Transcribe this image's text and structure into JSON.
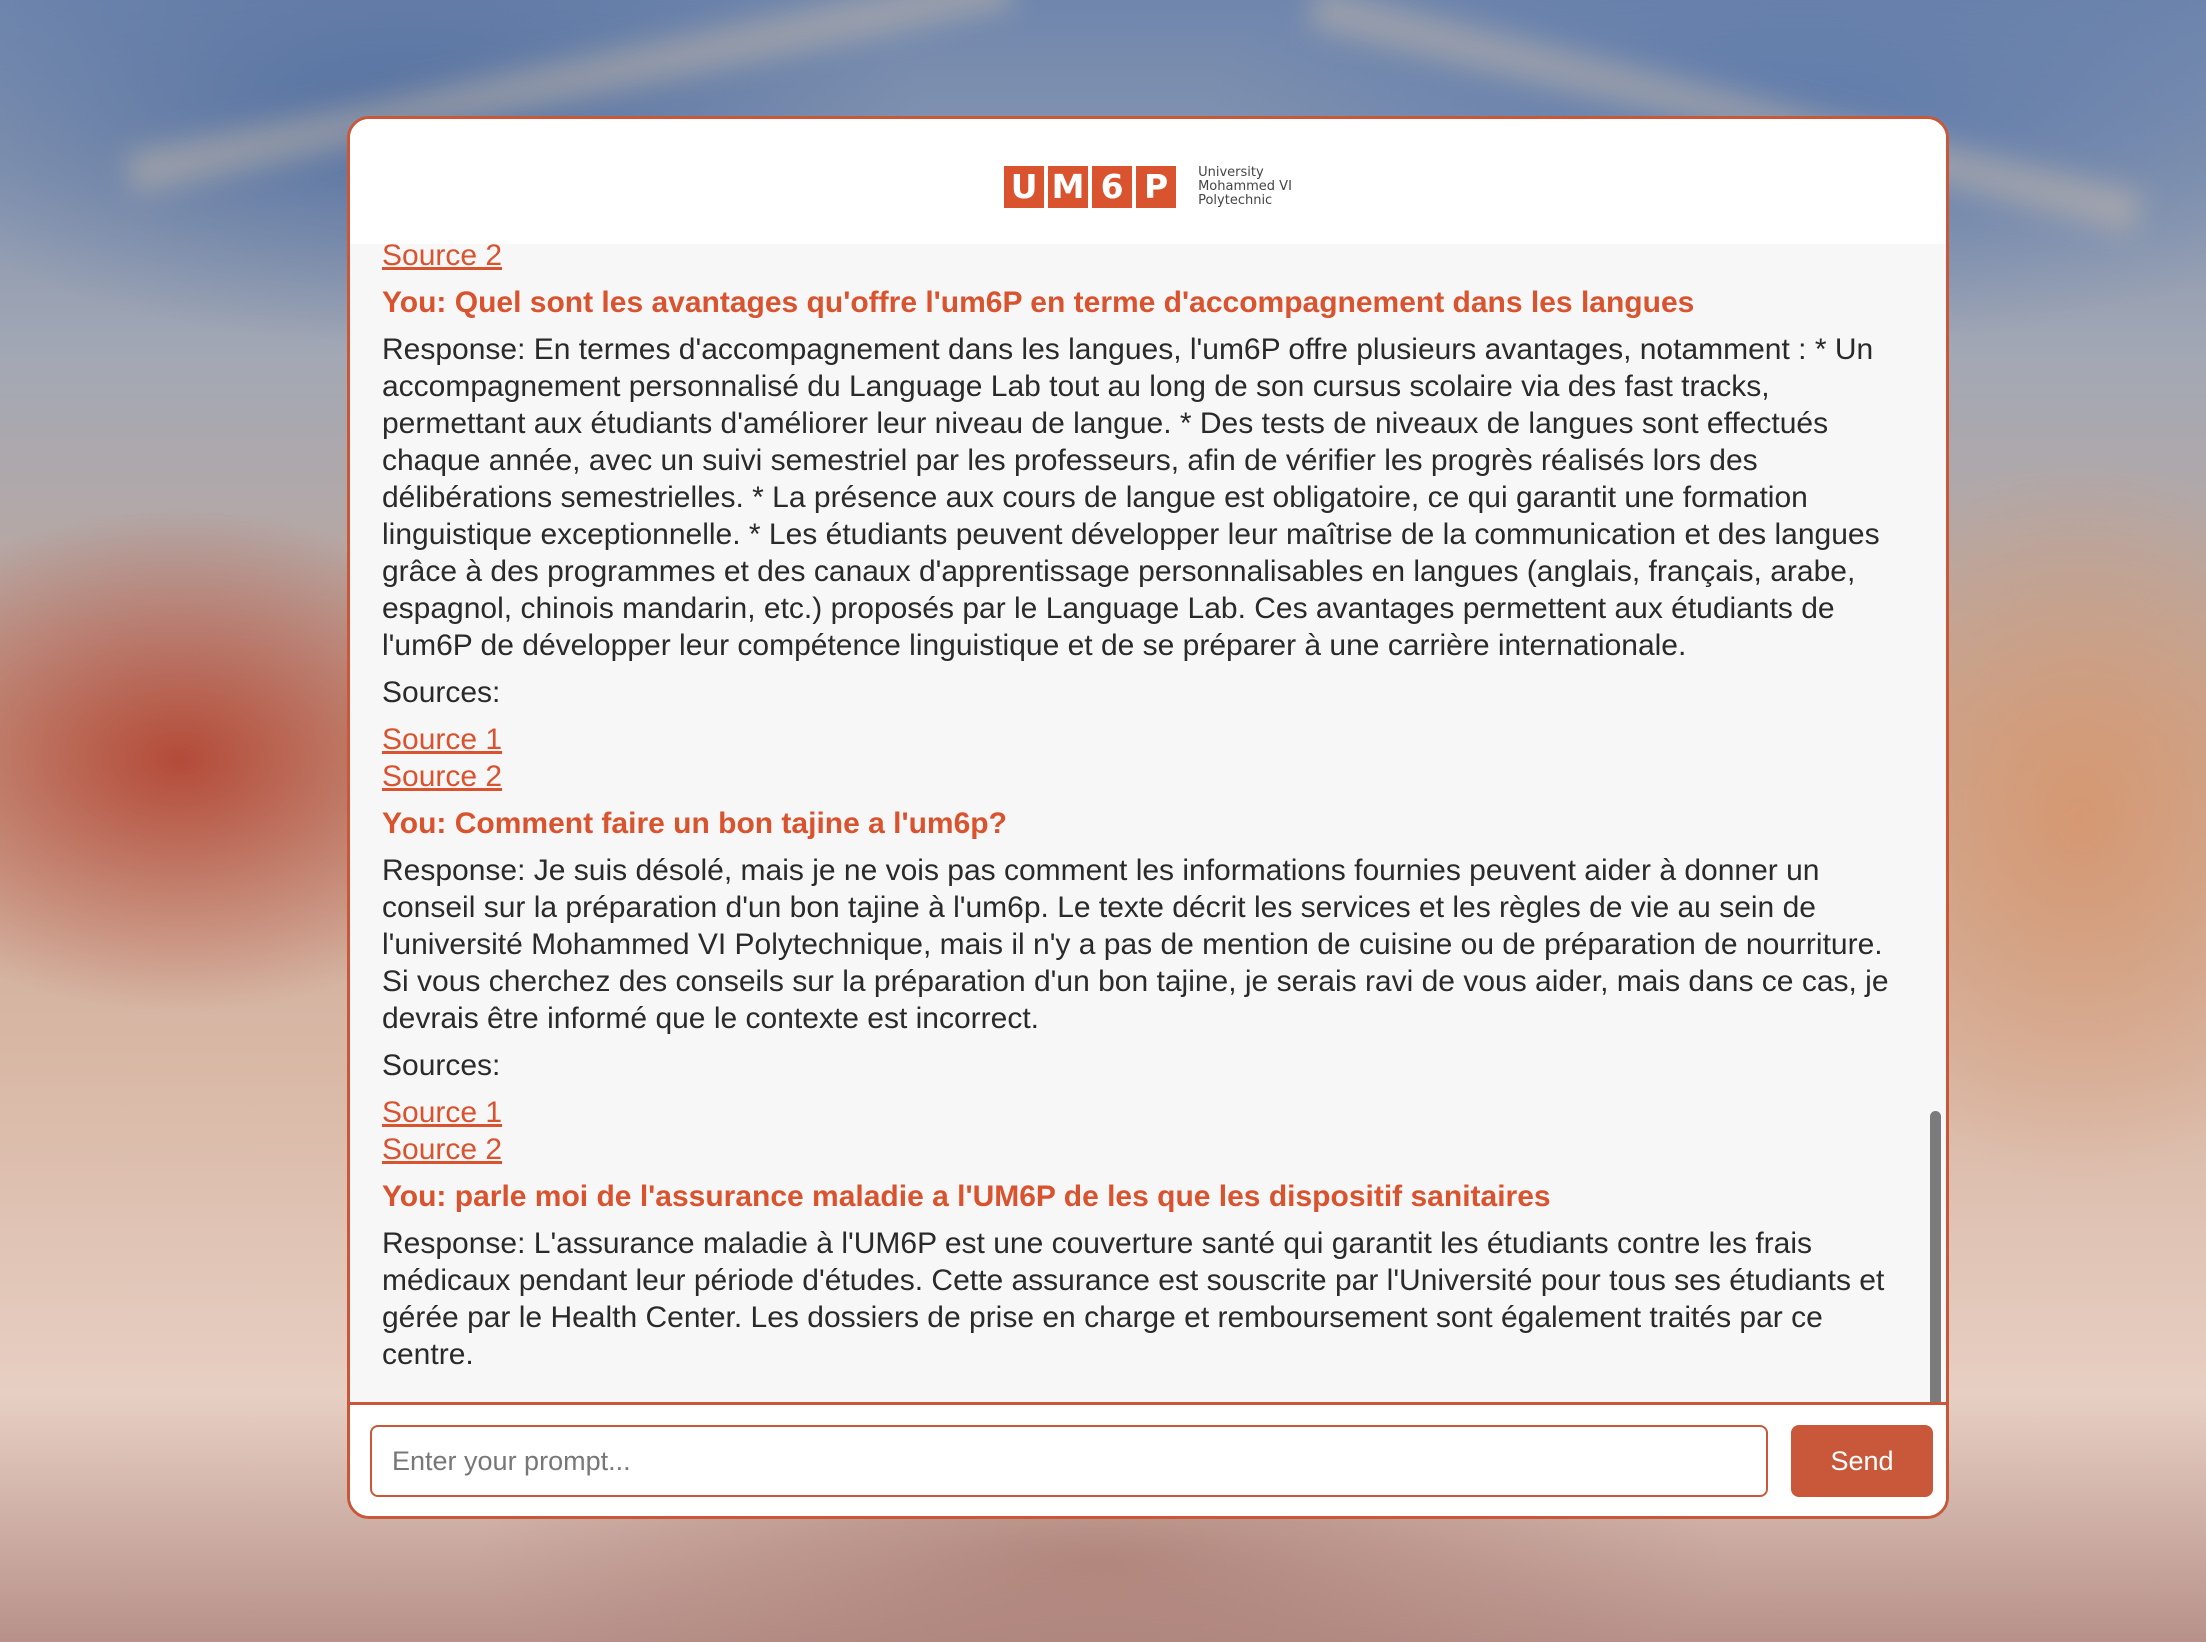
{
  "logo": {
    "letters": [
      "U",
      "M",
      "6",
      "P"
    ],
    "line1": "University",
    "line2": "Mohammed VI",
    "line3": "Polytechnic"
  },
  "chat": {
    "top_source": "Source 2",
    "sources_label": "Sources:",
    "messages": [
      {
        "question": "You: Quel sont les avantages qu'offre l'um6P en terme d'accompagnement dans les langues",
        "response": "Response: En termes d'accompagnement dans les langues, l'um6P offre plusieurs avantages, notamment : * Un accompagnement personnalisé du Language Lab tout au long de son cursus scolaire via des fast tracks, permettant aux étudiants d'améliorer leur niveau de langue. * Des tests de niveaux de langues sont effectués chaque année, avec un suivi semestriel par les professeurs, afin de vérifier les progrès réalisés lors des délibérations semestrielles. * La présence aux cours de langue est obligatoire, ce qui garantit une formation linguistique exceptionnelle. * Les étudiants peuvent développer leur maîtrise de la communication et des langues grâce à des programmes et des canaux d'apprentissage personnalisables en langues (anglais, français, arabe, espagnol, chinois mandarin, etc.) proposés par le Language Lab. Ces avantages permettent aux étudiants de l'um6P de développer leur compétence linguistique et de se préparer à une carrière internationale.",
        "sources": [
          "Source 1",
          "Source 2"
        ]
      },
      {
        "question": "You: Comment faire un bon tajine a l'um6p?",
        "response": "Response: Je suis désolé, mais je ne vois pas comment les informations fournies peuvent aider à donner un conseil sur la préparation d'un bon tajine à l'um6p. Le texte décrit les services et les règles de vie au sein de l'université Mohammed VI Polytechnique, mais il n'y a pas de mention de cuisine ou de préparation de nourriture. Si vous cherchez des conseils sur la préparation d'un bon tajine, je serais ravi de vous aider, mais dans ce cas, je devrais être informé que le contexte est incorrect.",
        "sources": [
          "Source 1",
          "Source 2"
        ]
      },
      {
        "question": "You: parle moi de l'assurance maladie a l'UM6P de les que les dispositif sanitaires",
        "response": "Response: L'assurance maladie à l'UM6P est une couverture santé qui garantit les étudiants contre les frais médicaux pendant leur période d'études. Cette assurance est souscrite par l'Université pour tous ses étudiants et gérée par le Health Center. Les dossiers de prise en charge et remboursement sont également traités par ce centre."
      }
    ]
  },
  "input": {
    "placeholder": "Enter your prompt...",
    "value": ""
  },
  "send_label": "Send",
  "colors": {
    "accent": "#c9583a",
    "logo": "#d9532f",
    "chat_bg": "#f7f7f7"
  }
}
